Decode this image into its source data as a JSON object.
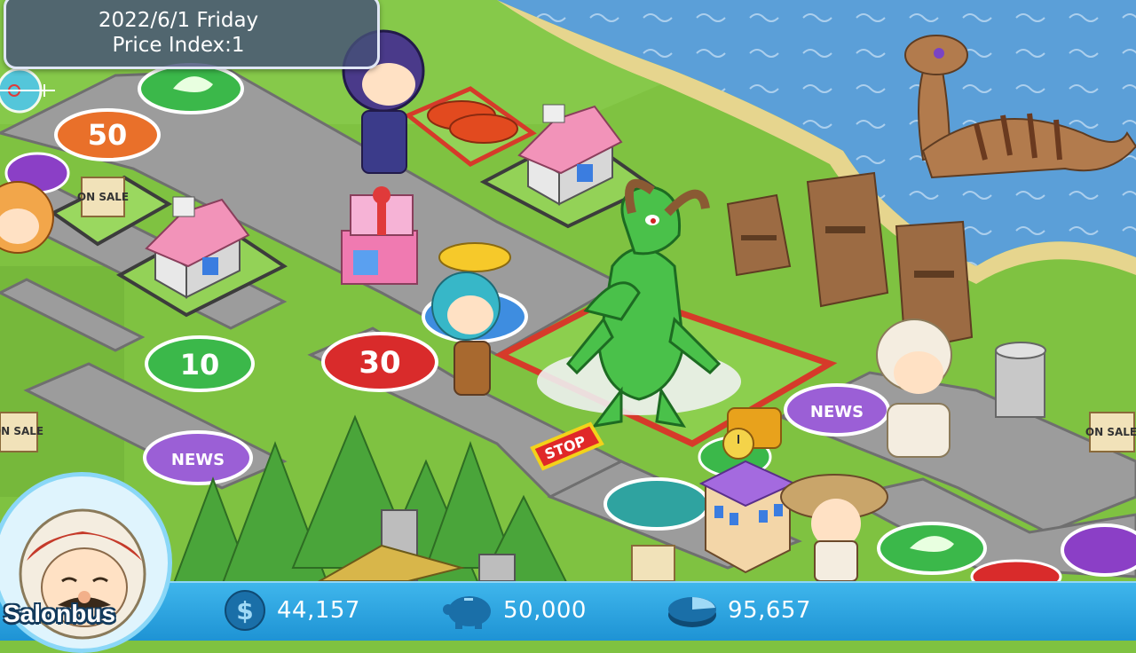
{
  "hud": {
    "date": "2022/6/1 Friday",
    "price_index": "Price Index:1"
  },
  "player": {
    "name": "Salonbus",
    "cash": "44,157",
    "savings": "50,000",
    "total_assets": "95,657"
  },
  "board_labels": {
    "tile_50": "50",
    "tile_30": "30",
    "tile_10": "10",
    "news": "NEWS",
    "on_sale": "ON SALE",
    "stop": "STOP"
  },
  "icons": {
    "cash": "dollar-coin-icon",
    "savings": "piggy-bank-icon",
    "assets": "pie-chart-icon",
    "target": "crosshair-icon"
  },
  "colors": {
    "bar": "#2aa6e2",
    "grass": "#7fc241",
    "road": "#9c9c9c",
    "water": "#5b9fd8"
  }
}
